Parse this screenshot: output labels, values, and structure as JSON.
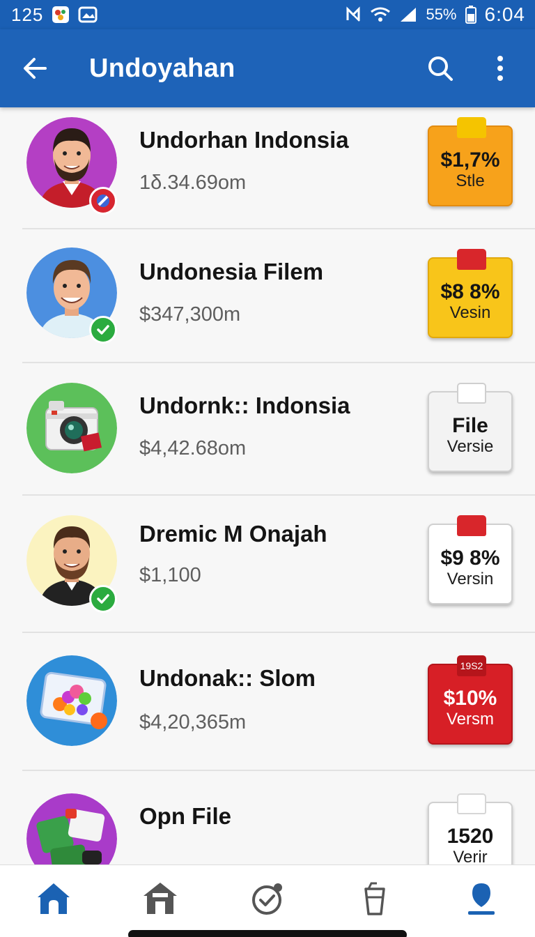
{
  "status_bar": {
    "time_left": "125",
    "battery_percent": "55%",
    "clock": "6:04"
  },
  "app_bar": {
    "title": "Undoyahan",
    "back_icon": "arrow-left-icon",
    "search_icon": "search-icon",
    "more_icon": "more-vertical-icon"
  },
  "items": [
    {
      "title": "Undorhan Indonsia",
      "subtitle": "1δ.34.69om",
      "tag_value": "$1,7%",
      "tag_label": "Stle",
      "tag_color": "#f7a21b",
      "clip_color": "#f5c400",
      "avatar": "man-beard-avatar",
      "badge": "stop-badge"
    },
    {
      "title": "Undonesia Filem",
      "subtitle": "$347,300m",
      "tag_value": "$8 8%",
      "tag_label": "Vesin",
      "tag_color": "#f8c51a",
      "clip_color": "#d8262b",
      "avatar": "man-smile-avatar",
      "badge": "check-badge"
    },
    {
      "title": "Undornk:: Indonsia",
      "subtitle": "$4,42.68om",
      "tag_value": "File",
      "tag_label": "Versie",
      "tag_color": "#f3f3f3",
      "clip_color": "#ffffff",
      "avatar": "camera-avatar",
      "badge": ""
    },
    {
      "title": "Dremic M Onajah",
      "subtitle": "$1,100",
      "tag_value": "$9 8%",
      "tag_label": "Versin",
      "tag_color": "#ffffff",
      "clip_color": "#d8262b",
      "avatar": "man-beard-avatar-2",
      "badge": "check-badge"
    },
    {
      "title": "Undonak:: Slom",
      "subtitle": "$4,20,365m",
      "tag_value": "$10%",
      "tag_label": "Versm",
      "tag_top": "19S2",
      "tag_color": "#d71f26",
      "clip_color": "#b5151b",
      "avatar": "flowers-avatar",
      "badge": ""
    },
    {
      "title": "Opn File",
      "subtitle": "",
      "tag_value": "1520",
      "tag_label": "Verir",
      "tag_color": "#ffffff",
      "clip_color": "#ffffff",
      "avatar": "apps-avatar",
      "badge": ""
    }
  ],
  "bottom_nav": [
    {
      "name": "home-icon",
      "active": true
    },
    {
      "name": "store-icon",
      "active": false
    },
    {
      "name": "activity-icon",
      "active": false
    },
    {
      "name": "cup-icon",
      "active": false
    },
    {
      "name": "profile-icon",
      "active": true
    }
  ],
  "colors": {
    "primary": "#1e63b8",
    "status_bar": "#1a5fb4",
    "nav_active": "#1b62b3",
    "nav_inactive": "#555555"
  }
}
